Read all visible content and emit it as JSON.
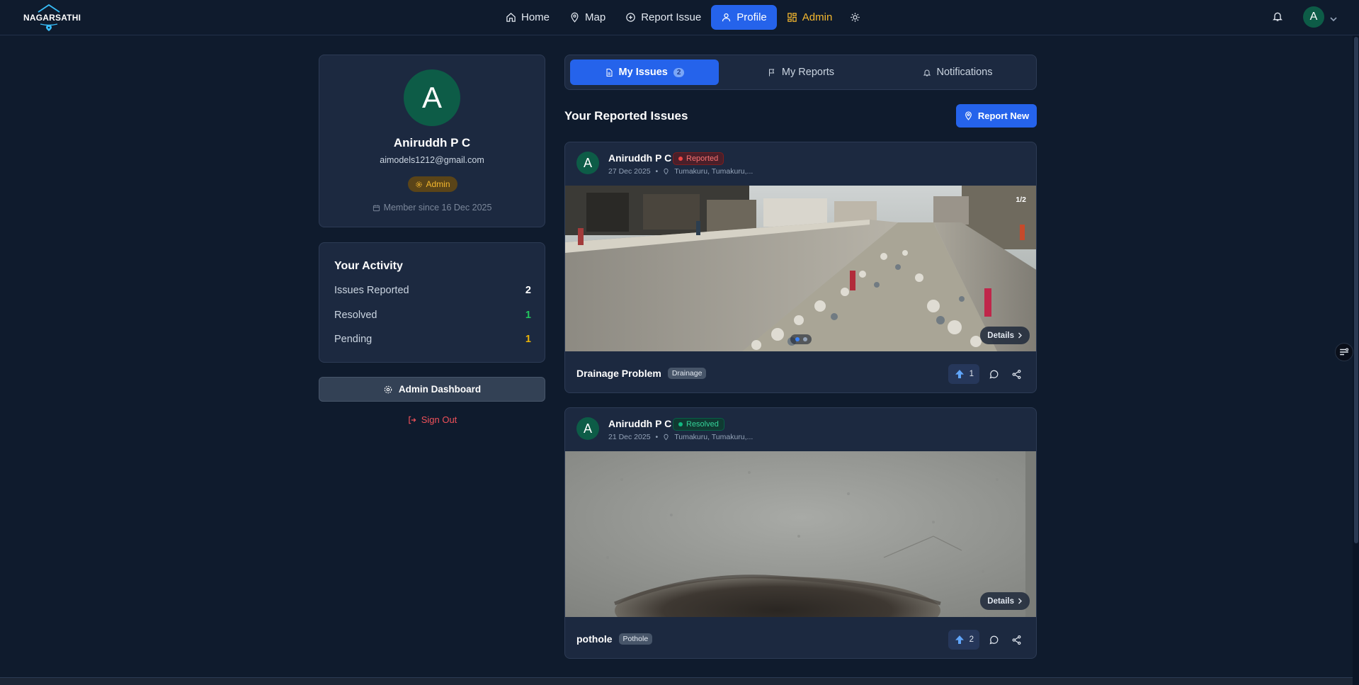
{
  "brand": {
    "name": "NAGARSATHI"
  },
  "nav": {
    "items": [
      {
        "label": "Home",
        "icon": "home-icon"
      },
      {
        "label": "Map",
        "icon": "map-pin-icon"
      },
      {
        "label": "Report Issue",
        "icon": "plus-circle-icon"
      },
      {
        "label": "Profile",
        "icon": "user-icon",
        "active": true
      },
      {
        "label": "Admin",
        "icon": "dashboard-icon"
      }
    ],
    "theme_icon": "sun-icon",
    "notification_icon": "bell-icon",
    "user_initial": "A"
  },
  "profile": {
    "initial": "A",
    "name": "Aniruddh P C",
    "email": "aimodels1212@gmail.com",
    "role": "Admin",
    "member_since": "Member since 16 Dec 2025"
  },
  "activity": {
    "title": "Your Activity",
    "rows": [
      {
        "label": "Issues Reported",
        "value": "2",
        "color": "#ffffff"
      },
      {
        "label": "Resolved",
        "value": "1",
        "color": "#22c55e"
      },
      {
        "label": "Pending",
        "value": "1",
        "color": "#eab308"
      }
    ]
  },
  "admin_dashboard_label": "Admin Dashboard",
  "sign_out_label": "Sign Out",
  "tabs": [
    {
      "label": "My Issues",
      "count": "2",
      "active": true,
      "icon": "file-icon"
    },
    {
      "label": "My Reports",
      "icon": "flag-icon"
    },
    {
      "label": "Notifications",
      "icon": "bell-icon"
    }
  ],
  "section_title": "Your Reported Issues",
  "report_new_label": "Report New",
  "issues": [
    {
      "author_initial": "A",
      "author": "Aniruddh P C",
      "status": "Reported",
      "status_color": "#ef4444",
      "date": "27 Dec 2025",
      "location": "Tumakuru, Tumakuru,...",
      "image_counter": "1/2",
      "details_label": "Details",
      "title": "Drainage Problem",
      "category": "Drainage",
      "upvotes": "1"
    },
    {
      "author_initial": "A",
      "author": "Aniruddh P C",
      "status": "Resolved",
      "status_color": "#10b981",
      "date": "21 Dec 2025",
      "location": "Tumakuru, Tumakuru,...",
      "details_label": "Details",
      "title": "pothole",
      "category": "Pothole",
      "upvotes": "2"
    }
  ]
}
